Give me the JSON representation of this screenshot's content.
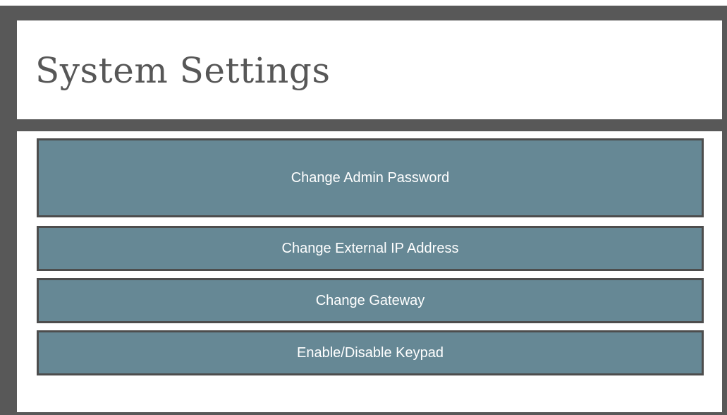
{
  "header": {
    "title": "System Settings"
  },
  "actions": [
    {
      "label": "Change Admin Password"
    },
    {
      "label": "Change External IP Address"
    },
    {
      "label": "Change Gateway"
    },
    {
      "label": "Enable/Disable Keypad"
    }
  ],
  "colors": {
    "frame": "#585858",
    "panel": "#ffffff",
    "button_fill": "#668895",
    "button_border": "#4d4d4d",
    "title_text": "#575757",
    "button_text": "#ffffff"
  }
}
